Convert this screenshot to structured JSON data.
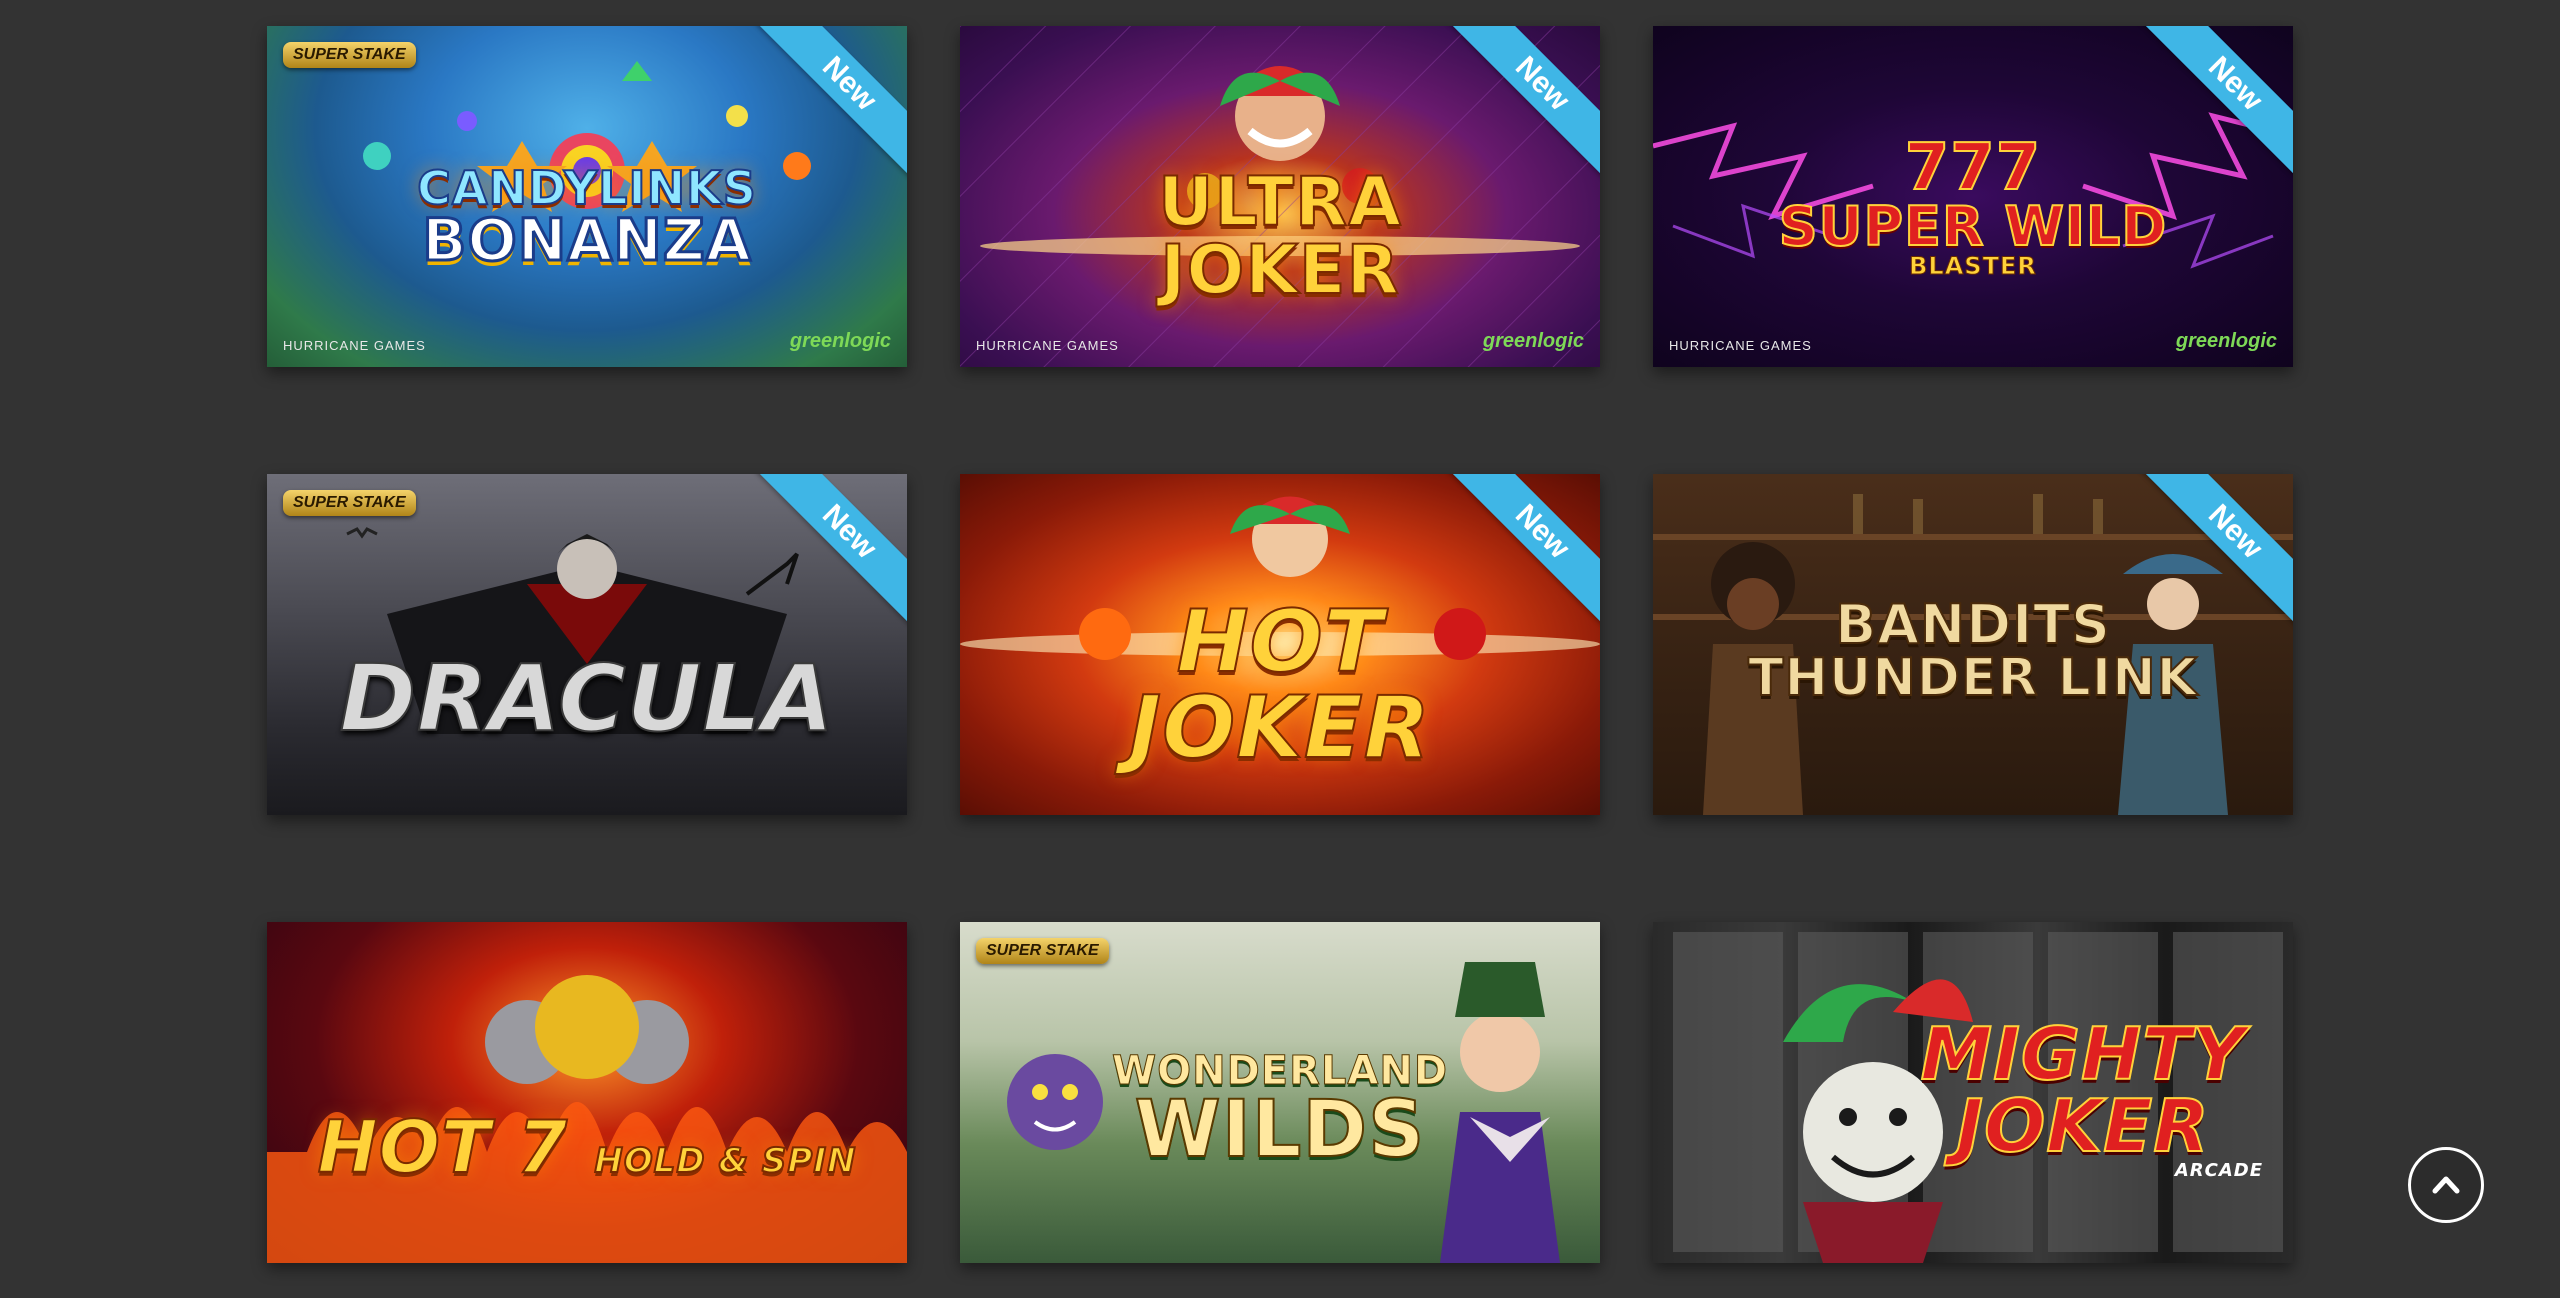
{
  "games": [
    {
      "title_l1": "CANDYLINKS",
      "title_l2": "BONANZA",
      "badge": "New",
      "supplier": "SUPER STAKE",
      "provider_left": "HURRICANE GAMES",
      "provider_right": "greenlogic"
    },
    {
      "title_l1": "ULTRA",
      "title_l2": "JOKER",
      "badge": "New",
      "provider_left": "HURRICANE GAMES",
      "provider_right": "greenlogic"
    },
    {
      "title_l1": "777",
      "title_l2": "SUPER WILD",
      "title_l3": "BLASTER",
      "badge": "New",
      "provider_left": "HURRICANE GAMES",
      "provider_right": "greenlogic"
    },
    {
      "title_l1": "DRACULA",
      "badge": "New",
      "supplier": "SUPER STAKE"
    },
    {
      "title_l1": "HOT",
      "title_l2": "JOKER",
      "badge": "New"
    },
    {
      "title_l1": "BANDITS",
      "title_l2": "THUNDER LINK",
      "badge": "New"
    },
    {
      "title_l1": "HOT 7",
      "title_l2": "HOLD & SPIN"
    },
    {
      "title_l1": "WONDERLAND",
      "title_l2": "WILDS",
      "supplier": "SUPER STAKE"
    },
    {
      "title_l1": "MIGHTY",
      "title_l2": "JOKER",
      "title_l3": "ARCADE"
    }
  ],
  "scroll_top": {
    "icon": "chevron-up-icon"
  }
}
